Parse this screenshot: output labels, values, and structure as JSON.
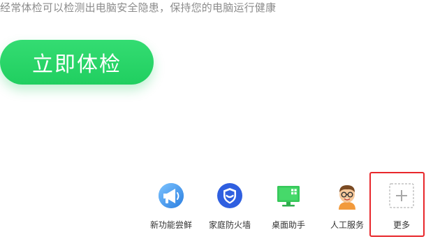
{
  "header": {
    "tagline": "经常体检可以检测出电脑安全隐患，保持您的电脑运行健康"
  },
  "scan": {
    "button_label": "立即体检"
  },
  "toolbar": {
    "items": [
      {
        "label": "新功能尝鲜",
        "icon": "megaphone-icon"
      },
      {
        "label": "家庭防火墙",
        "icon": "shield-icon"
      },
      {
        "label": "桌面助手",
        "icon": "monitor-icon"
      },
      {
        "label": "人工服务",
        "icon": "support-agent-icon"
      },
      {
        "label": "更多",
        "icon": "plus-icon"
      }
    ]
  },
  "colors": {
    "accent_green": "#22d063",
    "highlight_red": "#e8272b",
    "shield_blue": "#2f5fe0",
    "text_gray": "#8c8c8c"
  }
}
